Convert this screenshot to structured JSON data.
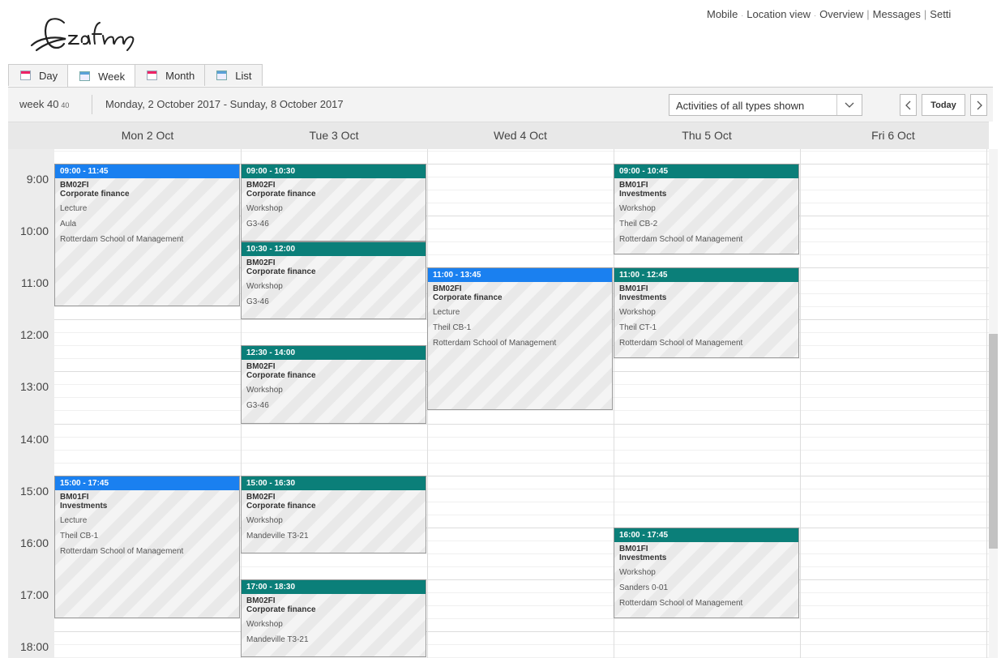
{
  "top_links": [
    {
      "label": "Mobile",
      "sep": "·"
    },
    {
      "label": "Location view",
      "sep": "·"
    },
    {
      "label": "Overview",
      "sep": "|"
    },
    {
      "label": "Messages",
      "sep": "|"
    },
    {
      "label": "Setti",
      "sep": ""
    }
  ],
  "tabs": [
    {
      "label": "Day",
      "icon": "calendar-day-icon"
    },
    {
      "label": "Week",
      "icon": "calendar-week-icon",
      "active": true
    },
    {
      "label": "Month",
      "icon": "calendar-month-icon"
    },
    {
      "label": "List",
      "icon": "list-icon"
    }
  ],
  "toolbar": {
    "week_label": "week 40",
    "week_small": "40",
    "date_range": "Monday, 2 October 2017 - Sunday, 8 October 2017",
    "filter_value": "Activities of all types shown",
    "prev": "<",
    "today_label": "Today",
    "next": ">"
  },
  "days": [
    "Mon 2 Oct",
    "Tue 3 Oct",
    "Wed 4 Oct",
    "Thu 5 Oct",
    "Fri 6 Oct"
  ],
  "hours": [
    "9:00",
    "10:00",
    "11:00",
    "12:00",
    "13:00",
    "14:00",
    "15:00",
    "16:00",
    "17:00",
    "18:00"
  ],
  "colors": {
    "lecture": "#1a80f0",
    "workshop": "#0b7f79"
  },
  "events": [
    {
      "day": 0,
      "start": 9.0,
      "end": 11.75,
      "time": "09:00 - 11:45",
      "code": "BM02FI",
      "name": "Corporate finance",
      "type": "Lecture",
      "room": "Aula",
      "location": "Rotterdam School of Management",
      "color": "blue"
    },
    {
      "day": 0,
      "start": 15.0,
      "end": 17.75,
      "time": "15:00 - 17:45",
      "code": "BM01FI",
      "name": "Investments",
      "type": "Lecture",
      "room": "Theil CB-1",
      "location": "Rotterdam School of Management",
      "color": "blue"
    },
    {
      "day": 1,
      "start": 9.0,
      "end": 10.5,
      "time": "09:00 - 10:30",
      "code": "BM02FI",
      "name": "Corporate finance",
      "type": "Workshop",
      "room": "G3-46",
      "location": "",
      "color": "teal"
    },
    {
      "day": 1,
      "start": 10.5,
      "end": 12.0,
      "time": "10:30 - 12:00",
      "code": "BM02FI",
      "name": "Corporate finance",
      "type": "Workshop",
      "room": "G3-46",
      "location": "",
      "color": "teal"
    },
    {
      "day": 1,
      "start": 12.5,
      "end": 14.0,
      "time": "12:30 - 14:00",
      "code": "BM02FI",
      "name": "Corporate finance",
      "type": "Workshop",
      "room": "G3-46",
      "location": "",
      "color": "teal"
    },
    {
      "day": 1,
      "start": 15.0,
      "end": 16.5,
      "time": "15:00 - 16:30",
      "code": "BM02FI",
      "name": "Corporate finance",
      "type": "Workshop",
      "room": "Mandeville T3-21",
      "location": "",
      "color": "teal"
    },
    {
      "day": 1,
      "start": 17.0,
      "end": 18.5,
      "time": "17:00 - 18:30",
      "code": "BM02FI",
      "name": "Corporate finance",
      "type": "Workshop",
      "room": "Mandeville T3-21",
      "location": "",
      "color": "teal"
    },
    {
      "day": 2,
      "start": 11.0,
      "end": 13.75,
      "time": "11:00 - 13:45",
      "code": "BM02FI",
      "name": "Corporate finance",
      "type": "Lecture",
      "room": "Theil CB-1",
      "location": "Rotterdam School of Management",
      "color": "blue"
    },
    {
      "day": 3,
      "start": 9.0,
      "end": 10.75,
      "time": "09:00 - 10:45",
      "code": "BM01FI",
      "name": "Investments",
      "type": "Workshop",
      "room": "Theil CB-2",
      "location": "Rotterdam School of Management",
      "color": "teal"
    },
    {
      "day": 3,
      "start": 11.0,
      "end": 12.75,
      "time": "11:00 - 12:45",
      "code": "BM01FI",
      "name": "Investments",
      "type": "Workshop",
      "room": "Theil CT-1",
      "location": "Rotterdam School of Management",
      "color": "teal"
    },
    {
      "day": 3,
      "start": 16.0,
      "end": 17.75,
      "time": "16:00 - 17:45",
      "code": "BM01FI",
      "name": "Investments",
      "type": "Workshop",
      "room": "Sanders 0-01",
      "location": "Rotterdam School of Management",
      "color": "teal"
    }
  ]
}
